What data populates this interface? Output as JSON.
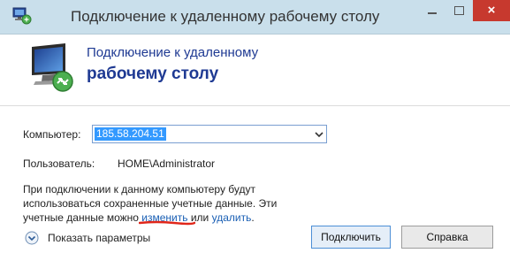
{
  "window": {
    "title": "Подключение к удаленному рабочему столу",
    "controls": {
      "minimize": "minimize",
      "maximize": "maximize",
      "close": "×"
    }
  },
  "banner": {
    "line1": "Подключение к удаленному",
    "line2": "рабочему столу"
  },
  "form": {
    "computer_label": "Компьютер:",
    "computer_value": "185.58.204.51",
    "user_label": "Пользователь:",
    "user_value": "HOME\\Administrator"
  },
  "info": {
    "line1": "При подключении к данному компьютеру будут",
    "line2": "использоваться сохраненные учетные данные. Эти",
    "line3_prefix": "учетные данные можно ",
    "link_change": "изменить",
    "middle": " или ",
    "link_delete": "удалить",
    "suffix": "."
  },
  "footer": {
    "show_params": "Показать параметры",
    "connect": "Подключить",
    "help": "Справка"
  },
  "colors": {
    "titlebar": "#c9dfeb",
    "close_button": "#c7392e",
    "banner_text": "#1f3a93",
    "link": "#1a5fb4",
    "selection": "#3399ff",
    "annotation_underline": "#e0261a"
  },
  "icons": {
    "app": "remote-desktop-icon",
    "banner": "remote-desktop-monitor-icon",
    "dropdown": "chevron-down-icon",
    "expand": "expand-circle-icon"
  }
}
